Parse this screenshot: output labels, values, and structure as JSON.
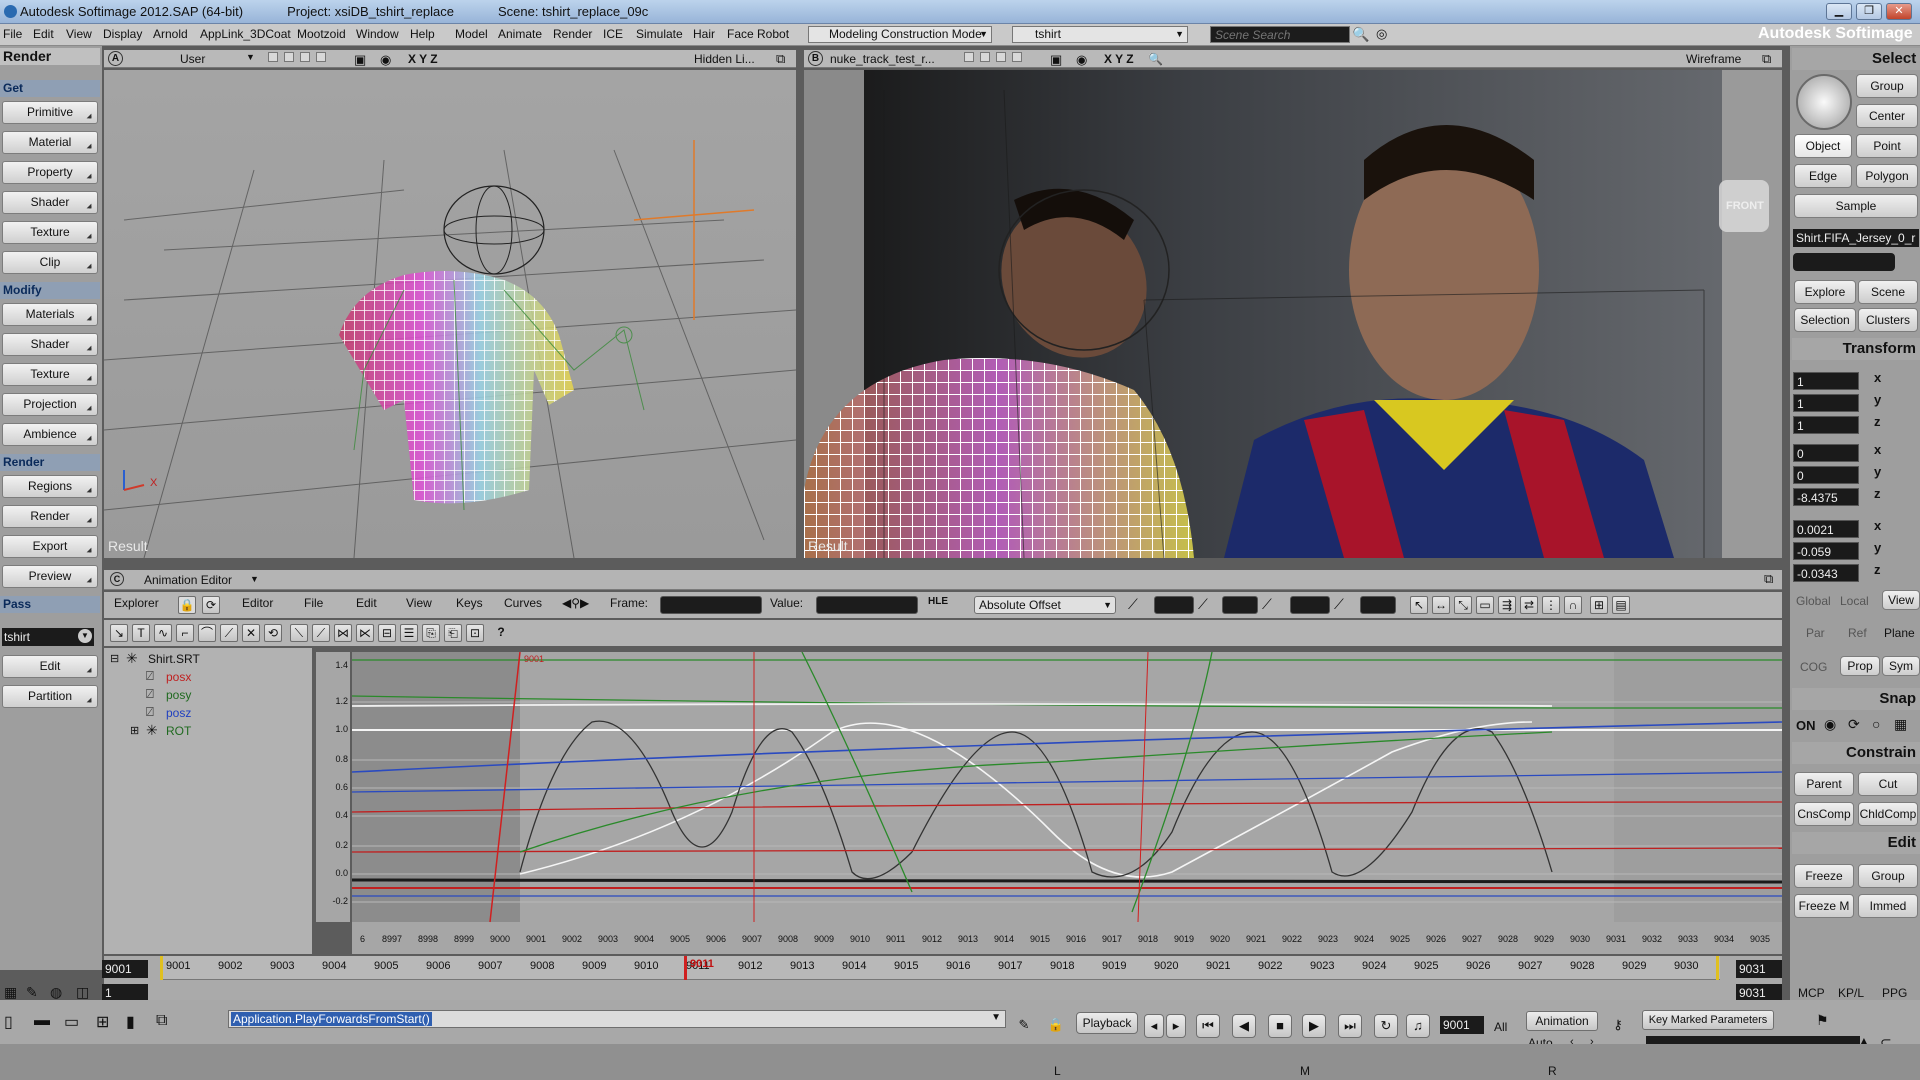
{
  "window": {
    "title": "Autodesk Softimage 2012.SAP (64-bit)",
    "project": "Project: xsiDB_tshirt_replace",
    "scene": "Scene: tshirt_replace_09c",
    "minimize": "▁",
    "restore": "❐",
    "close": "✕"
  },
  "menubar": {
    "items": [
      "File",
      "Edit",
      "View",
      "Display",
      "Arnold",
      "AppLink_3DCoat",
      "Mootzoid",
      "Window",
      "Help",
      "Model",
      "Animate",
      "Render",
      "ICE",
      "Simulate",
      "Hair",
      "Face Robot"
    ],
    "mode_combo": "Modeling Construction Mode",
    "object_combo": "tshirt",
    "search_placeholder": "Scene Search",
    "brand": "Autodesk Softimage"
  },
  "left_panel": {
    "toolbar_title": "Render",
    "get_header": "Get",
    "get_items": [
      "Primitive",
      "Material",
      "Property",
      "Shader",
      "Texture",
      "Clip"
    ],
    "modify_header": "Modify",
    "modify_items": [
      "Materials",
      "Shader",
      "Texture",
      "Projection",
      "Ambience"
    ],
    "render_header": "Render",
    "render_items": [
      "Regions",
      "Render",
      "Export",
      "Preview"
    ],
    "pass_header": "Pass",
    "pass_value": "tshirt",
    "pass_items": [
      "Edit",
      "Partition"
    ]
  },
  "viewport_a": {
    "letter": "A",
    "camera": "User",
    "axes": "X Y Z",
    "display_mode": "Hidden Li...",
    "result_label": "Result"
  },
  "viewport_b": {
    "letter": "B",
    "camera": "nuke_track_test_r...",
    "axes": "X Y Z",
    "display_mode": "Wireframe",
    "result_label": "Result",
    "front_label": "FRONT"
  },
  "right_panel": {
    "select_header": "Select",
    "select_buttons": [
      "Group",
      "Center",
      "Object",
      "Point",
      "Edge",
      "Polygon",
      "Sample"
    ],
    "selected_object": "Shirt.FIFA_Jersey_0_r",
    "explore_buttons": [
      "Explore",
      "Scene",
      "Selection",
      "Clusters"
    ],
    "transform_header": "Transform",
    "scale": [
      "1",
      "1",
      "1"
    ],
    "rotate": [
      "0",
      "0",
      "-8.4375"
    ],
    "translate": [
      "0.0021",
      "-0.059",
      "-0.0343"
    ],
    "axis_labels": [
      "x",
      "y",
      "z"
    ],
    "space_labels": [
      "Global",
      "Local",
      "View"
    ],
    "space_labels2": [
      "Par",
      "Ref",
      "Plane"
    ],
    "space_labels3": [
      "COG",
      "Prop",
      "Sym"
    ],
    "snap_header": "Snap",
    "snap_on": "ON",
    "constrain_header": "Constrain",
    "constrain_buttons": [
      "Parent",
      "Cut",
      "CnsComp",
      "ChldComp"
    ],
    "edit_header": "Edit",
    "edit_buttons": [
      "Freeze",
      "Group",
      "Freeze M",
      "Immed"
    ],
    "bottom_tabs": [
      "MCP",
      "KP/L",
      "PPG"
    ]
  },
  "anim_editor": {
    "letter": "C",
    "title": "Animation Editor",
    "menu": [
      "Explorer",
      "Editor",
      "File",
      "Edit",
      "View",
      "Keys",
      "Curves"
    ],
    "frame_label": "Frame:",
    "value_label": "Value:",
    "offset_mode": "Absolute Offset",
    "hle_label": "HLE",
    "tree": {
      "root": "Shirt.SRT",
      "children": [
        "posx",
        "posy",
        "posz"
      ],
      "rot": "ROT"
    },
    "y_ticks": [
      "1.4",
      "1.2",
      "1.0",
      "0.8",
      "0.6",
      "0.4",
      "0.2",
      "0.0",
      "-0.2"
    ],
    "x_ticks": [
      "6",
      "8997",
      "8998",
      "8999",
      "9000",
      "9001",
      "9002",
      "9003",
      "9004",
      "9005",
      "9006",
      "9007",
      "9008",
      "9009",
      "9010",
      "9011",
      "9012",
      "9013",
      "9014",
      "9015",
      "9016",
      "9017",
      "9018",
      "9019",
      "9020",
      "9021",
      "9022",
      "9023",
      "9024",
      "9025",
      "9026",
      "9027",
      "9028",
      "9029",
      "9030",
      "9031",
      "9032",
      "9033",
      "9034",
      "9035"
    ],
    "current_frame_label": "9001",
    "help": "?"
  },
  "timeline": {
    "start": "9001",
    "start2": "1",
    "end": "9031",
    "end2": "9031",
    "ticks": [
      "9001",
      "9002",
      "9003",
      "9004",
      "9005",
      "9006",
      "9007",
      "9008",
      "9009",
      "9010",
      "9011",
      "9012",
      "9013",
      "9014",
      "9015",
      "9016",
      "9017",
      "9018",
      "9019",
      "9020",
      "9021",
      "9022",
      "9023",
      "9024",
      "9025",
      "9026",
      "9027",
      "9028",
      "9029",
      "9030"
    ],
    "current": "9011"
  },
  "bottom": {
    "command": "Application.PlayForwardsFromStart()",
    "playback_label": "Playback",
    "current_frame": "9001",
    "all_label": "All",
    "animation_label": "Animation",
    "auto_label": "Auto",
    "key_marked": "Key Marked Parameters",
    "status_l": "L",
    "status_m": "M",
    "status_r": "R"
  }
}
